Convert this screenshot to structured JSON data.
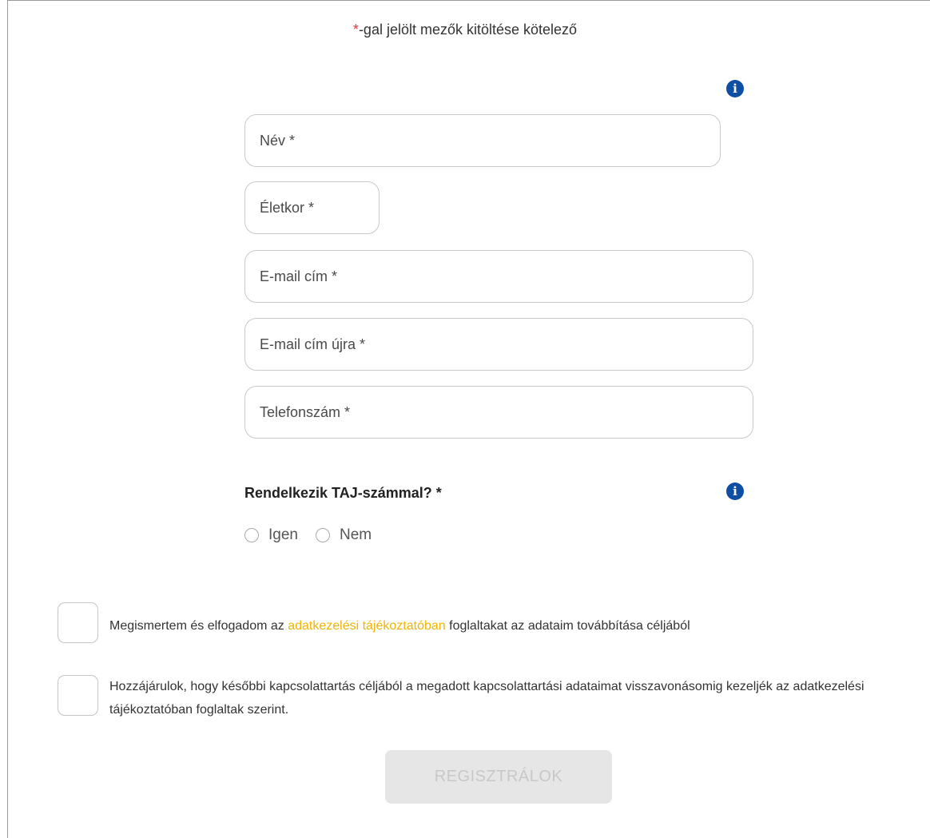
{
  "header": {
    "required_star": "*",
    "required_note": "-gal jelölt mezők kitöltése kötelező"
  },
  "info_icon_glyph": "i",
  "fields": {
    "name_placeholder": "Név *",
    "age_placeholder": "Életkor *",
    "email_placeholder": "E-mail cím *",
    "email_repeat_placeholder": "E-mail cím újra *",
    "phone_placeholder": "Telefonszám *"
  },
  "taj": {
    "question": "Rendelkezik TAJ-számmal? *",
    "option_yes": "Igen",
    "option_no": "Nem"
  },
  "consent": {
    "first_before": "Megismertem és elfogadom az ",
    "first_link": "adatkezelési tájékoztatóban",
    "first_after": " foglaltakat az adataim továbbítása céljából",
    "second": "Hozzájárulok, hogy későbbi kapcsolattartás céljából a megadott kapcsolattartási adataimat visszavonásomig kezeljék az adatkezelési tájékoztatóban foglaltak szerint."
  },
  "submit_label": "REGISZTRÁLOK",
  "colors": {
    "required_star": "#e03a3a",
    "info_icon": "#0f4fa3",
    "link": "#f0b400",
    "submit_disabled_bg": "#e6e6e6"
  }
}
